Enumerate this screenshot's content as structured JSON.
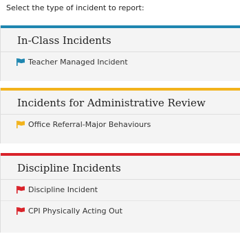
{
  "prompt": "Select the type of incident to report:",
  "sections": [
    {
      "title": "In-Class Incidents",
      "accent": "#1e86b0",
      "items": [
        {
          "label": "Teacher Managed Incident",
          "icon": "flag-icon",
          "color": "#1e86b0"
        }
      ]
    },
    {
      "title": "Incidents for Administrative Review",
      "accent": "#f2b31c",
      "items": [
        {
          "label": "Office Referral-Major Behaviours",
          "icon": "flag-icon",
          "color": "#f2b31c"
        }
      ]
    },
    {
      "title": "Discipline Incidents",
      "accent": "#d9232a",
      "items": [
        {
          "label": "Discipline Incident",
          "icon": "flag-icon",
          "color": "#d9232a"
        },
        {
          "label": "CPI Physically Acting Out",
          "icon": "flag-icon",
          "color": "#d9232a"
        }
      ]
    }
  ]
}
